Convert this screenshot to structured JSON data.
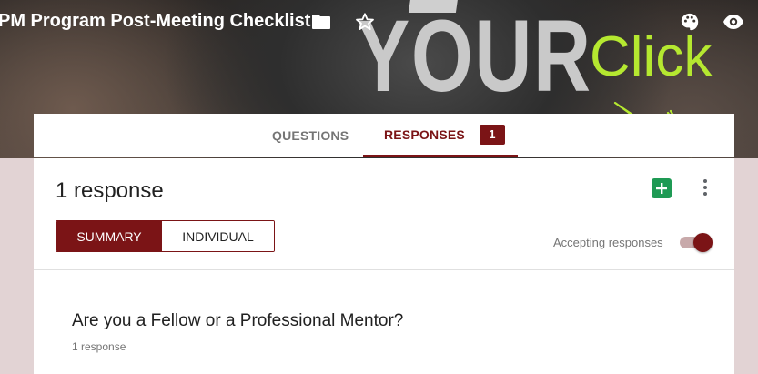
{
  "header": {
    "form_title": "PM Program Post-Meeting Checklist",
    "background_text": "YOUR",
    "icons": [
      "folder-icon",
      "star-icon",
      "palette-icon",
      "eye-icon"
    ]
  },
  "annotation": {
    "click_label": "Click",
    "color": "#b5e830"
  },
  "tabs": {
    "questions_label": "QUESTIONS",
    "responses_label": "RESPONSES",
    "responses_badge": "1",
    "active": "responses"
  },
  "responses": {
    "count_text": "1 response",
    "sheets_icon": "sheets-icon",
    "more_icon": "more-vert-icon",
    "summary_label": "SUMMARY",
    "individual_label": "INDIVIDUAL",
    "active_view": "summary",
    "accepting_label": "Accepting responses",
    "accepting_on": true
  },
  "question": {
    "title": "Are you a Fellow or a Professional Mentor?",
    "response_count": "1 response"
  },
  "colors": {
    "accent": "#7b1416",
    "page_background": "#e2d3d4",
    "sheets_green": "#1e9a54"
  }
}
